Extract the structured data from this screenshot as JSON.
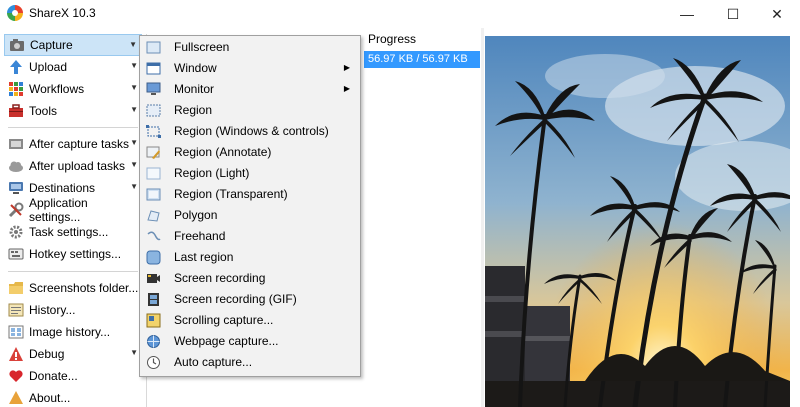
{
  "window": {
    "title": "ShareX 10.3",
    "minimize": "—",
    "maximize": "☐",
    "close": "✕"
  },
  "left_menu": {
    "items": [
      {
        "label": "Capture",
        "icon": "camera-icon",
        "arrow": "▼"
      },
      {
        "label": "Upload",
        "icon": "upload-arrow-icon",
        "arrow": "▼"
      },
      {
        "label": "Workflows",
        "icon": "workflows-grid-icon",
        "arrow": "▼"
      },
      {
        "label": "Tools",
        "icon": "toolbox-icon",
        "arrow": "▼"
      },
      {
        "label": "After capture tasks",
        "icon": "after-capture-icon",
        "arrow": "▼"
      },
      {
        "label": "After upload tasks",
        "icon": "cloud-icon",
        "arrow": "▼"
      },
      {
        "label": "Destinations",
        "icon": "destinations-icon",
        "arrow": "▼"
      },
      {
        "label": "Application settings...",
        "icon": "wrench-icon"
      },
      {
        "label": "Task settings...",
        "icon": "gear-icon"
      },
      {
        "label": "Hotkey settings...",
        "icon": "keyboard-icon"
      },
      {
        "label": "Screenshots folder...",
        "icon": "folder-icon"
      },
      {
        "label": "History...",
        "icon": "history-icon"
      },
      {
        "label": "Image history...",
        "icon": "image-history-icon"
      },
      {
        "label": "Debug",
        "icon": "debug-icon",
        "arrow": "▼"
      },
      {
        "label": "Donate...",
        "icon": "heart-icon"
      },
      {
        "label": "About...",
        "icon": "about-icon"
      }
    ]
  },
  "list": {
    "progress_header": "Progress",
    "progress_value": "56.97 KB / 56.97 KB"
  },
  "capture_menu": {
    "items": [
      {
        "label": "Fullscreen"
      },
      {
        "label": "Window",
        "arrow": "▶"
      },
      {
        "label": "Monitor",
        "arrow": "▶"
      },
      {
        "label": "Region"
      },
      {
        "label": "Region (Windows & controls)"
      },
      {
        "label": "Region (Annotate)"
      },
      {
        "label": "Region (Light)"
      },
      {
        "label": "Region (Transparent)"
      },
      {
        "label": "Polygon"
      },
      {
        "label": "Freehand"
      },
      {
        "label": "Last region"
      },
      {
        "label": "Screen recording"
      },
      {
        "label": "Screen recording (GIF)"
      },
      {
        "label": "Scrolling capture..."
      },
      {
        "label": "Webpage capture..."
      },
      {
        "label": "Auto capture..."
      }
    ]
  },
  "colors": {
    "accent": "#3399ff",
    "menu_bg": "#f2f2f2",
    "active_bg": "#cce4f7"
  }
}
